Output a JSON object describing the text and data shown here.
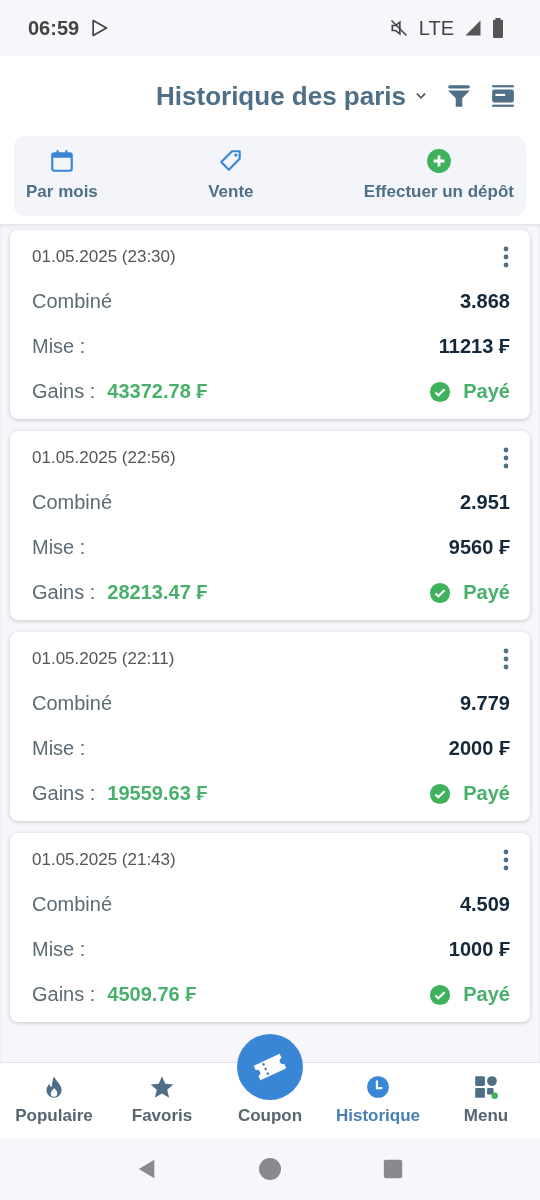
{
  "status_bar": {
    "time": "06:59",
    "network": "LTE"
  },
  "header": {
    "title": "Historique des paris"
  },
  "quick_actions": [
    {
      "label": "Par mois",
      "kind": "calendar"
    },
    {
      "label": "Vente",
      "kind": "tag"
    },
    {
      "label": "Effectuer un dépôt",
      "kind": "deposit"
    }
  ],
  "bets": [
    {
      "date": "01.05.2025 (23:30)",
      "type_label": "Combiné",
      "odds": "3.868",
      "stake_label": "Mise :",
      "stake": "11213 ₣",
      "winnings_label": "Gains :",
      "winnings": "43372.78 ₣",
      "status": "Payé",
      "kind": "paid"
    },
    {
      "date": "01.05.2025 (22:56)",
      "type_label": "Combiné",
      "odds": "2.951",
      "stake_label": "Mise :",
      "stake": "9560 ₣",
      "winnings_label": "Gains :",
      "winnings": "28213.47 ₣",
      "status": "Payé",
      "kind": "paid"
    },
    {
      "date": "01.05.2025 (22:11)",
      "type_label": "Combiné",
      "odds": "9.779",
      "stake_label": "Mise :",
      "stake": "2000 ₣",
      "winnings_label": "Gains :",
      "winnings": "19559.63 ₣",
      "status": "Payé",
      "kind": "paid"
    },
    {
      "date": "01.05.2025 (21:43)",
      "type_label": "Combiné",
      "odds": "4.509",
      "stake_label": "Mise :",
      "stake": "1000 ₣",
      "winnings_label": "Gains :",
      "winnings": "4509.76 ₣",
      "status": "Payé",
      "kind": "paid"
    }
  ],
  "bottom_nav": [
    {
      "label": "Populaire",
      "kind": "flame",
      "selected": false
    },
    {
      "label": "Favoris",
      "kind": "star",
      "selected": false
    },
    {
      "label": "Coupon",
      "kind": "coupon",
      "selected": false
    },
    {
      "label": "Historique",
      "kind": "clock",
      "selected": true
    },
    {
      "label": "Menu",
      "kind": "menu",
      "selected": false
    }
  ]
}
